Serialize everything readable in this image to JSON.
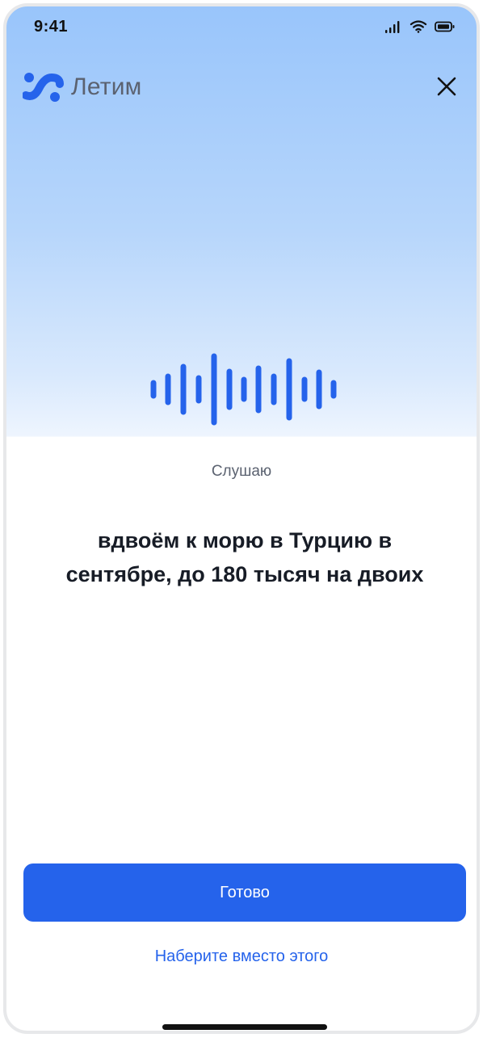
{
  "status_bar": {
    "time": "9:41",
    "icons": [
      "signal-icon",
      "wifi-icon",
      "battery-icon"
    ]
  },
  "header": {
    "logo_text": "Летим",
    "close_icon": "close-icon"
  },
  "voice": {
    "state_label": "Слушаю",
    "transcript": "вдвоём к морю в Турцию в сентябре, до 180 тысяч на двоих",
    "wave_icon": "sound-wave-icon"
  },
  "actions": {
    "done_label": "Готово",
    "type_instead_label": "Наберите вместо этого"
  },
  "colors": {
    "accent": "#2563eb",
    "text_primary": "#171c26",
    "text_secondary": "#5b6270",
    "gradient_top": "#99c5fb"
  }
}
